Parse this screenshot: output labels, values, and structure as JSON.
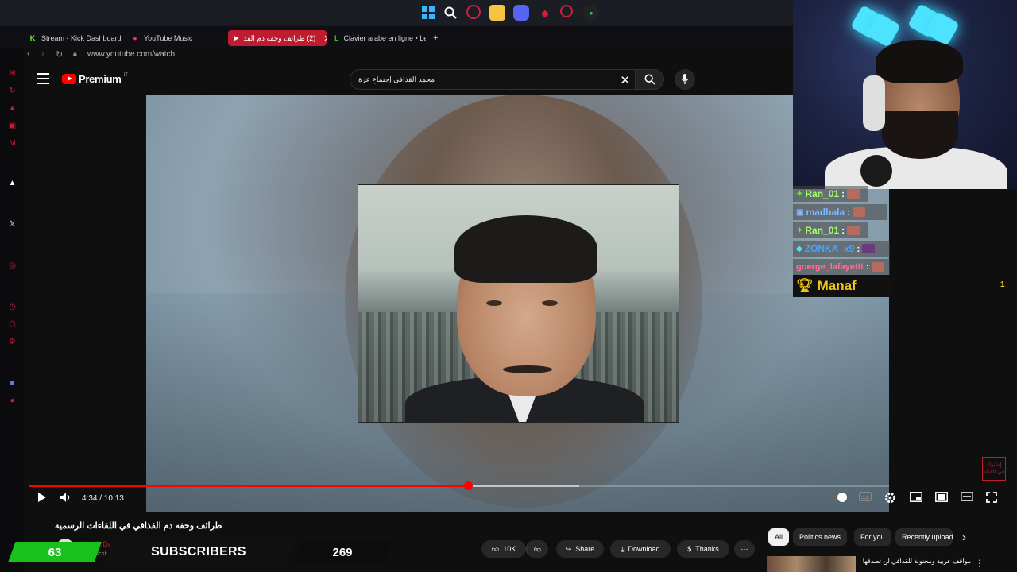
{
  "browser": {
    "tabs": [
      {
        "label": "Stream - Kick Dashboard",
        "favicon": "K"
      },
      {
        "label": "YouTube Music",
        "favicon": "●"
      },
      {
        "label": "(2) طرائف وخفه دم القذ",
        "favicon": "▶"
      },
      {
        "label": "Clavier arabe en ligne • Lexilogos",
        "favicon": "L"
      }
    ],
    "new_tab_label": "+",
    "url": "www.youtube.com/watch"
  },
  "youtube": {
    "brand": "Premium",
    "region": "IT",
    "search_query": "محمد القذافي إجتماع عزة"
  },
  "player": {
    "current_time": "4:34",
    "duration": "10:13",
    "time_display": "4:34 / 10:13",
    "progress_fraction": 0.5098,
    "buffered_fraction": 0.64
  },
  "video_info": {
    "title": "طرائف وخفه دم القذافي في اللقاءات الرسمية",
    "channel_name": "Aleph Dance",
    "channel_subs": "k subscribers",
    "likes": "10K",
    "share_label": "Share",
    "download_label": "Download",
    "thanks_label": "Thanks",
    "more_label": "⋯"
  },
  "chips": [
    "All",
    "Politics news",
    "For you",
    "Recently uploaded"
  ],
  "related_first_title": "مواقف عربية ومجنونة للقذافي لن تصدقها",
  "overlay": {
    "sub_count": "63",
    "sub_label": "SUBSCRIBERS",
    "sub_goal": "269"
  },
  "chat": {
    "messages": [
      {
        "user": "Ran_01",
        "color": "#a6ff6b"
      },
      {
        "user": "madhala",
        "color": "#7fb6ff"
      },
      {
        "user": "Ran_01",
        "color": "#a6ff6b"
      },
      {
        "user": "ZONKA_x9",
        "color": "#4aa3ff"
      },
      {
        "user": "goerge_lafayettt",
        "color": "#ff6f9a"
      }
    ],
    "separator": ":",
    "top_donor": "Manaf",
    "top_donor_rank": "1"
  },
  "watermark_text": "إشتوك في القناة",
  "colors": {
    "accent_red": "#ff0000",
    "tab_active": "#c01c2f",
    "subs_green": "#18c21a",
    "donor_gold": "#f5c518"
  }
}
